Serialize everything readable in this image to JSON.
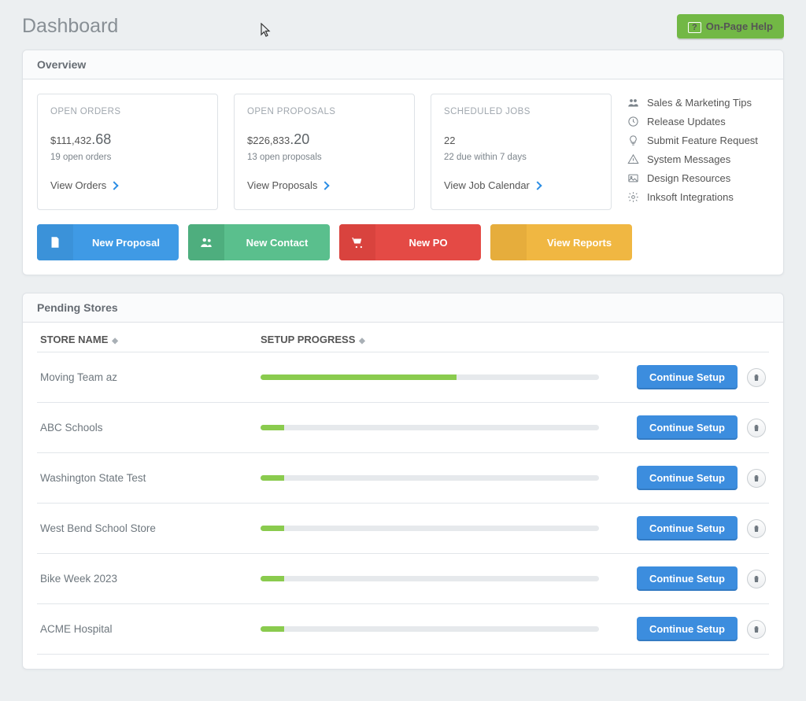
{
  "header": {
    "title": "Dashboard",
    "help_label": "On-Page Help"
  },
  "overview": {
    "title": "Overview",
    "open_orders": {
      "label": "OPEN ORDERS",
      "value_main": "$111,432",
      "value_cents": ".68",
      "sub": "19 open orders",
      "link": "View Orders"
    },
    "open_proposals": {
      "label": "OPEN PROPOSALS",
      "value_main": "$226,833",
      "value_cents": ".20",
      "sub": "13 open proposals",
      "link": "View Proposals"
    },
    "scheduled_jobs": {
      "label": "SCHEDULED JOBS",
      "value_main": "22",
      "sub": "22 due within 7 days",
      "link": "View Job Calendar"
    },
    "side_links": {
      "sales_tips": "Sales & Marketing Tips",
      "release": "Release Updates",
      "feature": "Submit Feature Request",
      "system": "System Messages",
      "design": "Design Resources",
      "integrations": "Inksoft Integrations"
    },
    "actions": {
      "new_proposal": "New Proposal",
      "new_contact": "New Contact",
      "new_po": "New PO",
      "view_reports": "View Reports"
    }
  },
  "pending": {
    "title": "Pending Stores",
    "columns": {
      "store_name": "STORE NAME",
      "setup_progress": "SETUP PROGRESS"
    },
    "continue_label": "Continue Setup",
    "rows": [
      {
        "name": "Moving Team az",
        "progress": 58
      },
      {
        "name": "ABC Schools",
        "progress": 7
      },
      {
        "name": "Washington State Test",
        "progress": 7
      },
      {
        "name": "West Bend School Store",
        "progress": 7
      },
      {
        "name": "Bike Week 2023",
        "progress": 7
      },
      {
        "name": "ACME Hospital",
        "progress": 7
      }
    ]
  }
}
